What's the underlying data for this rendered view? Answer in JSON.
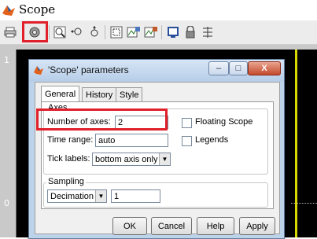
{
  "window": {
    "title": "Scope"
  },
  "toolbar": {
    "icons": [
      "print-icon",
      "parameters-icon",
      "zoom-in-icon",
      "zoom-x-icon",
      "zoom-y-icon",
      "autoscale-icon",
      "save-axes-icon",
      "restore-axes-icon",
      "float-icon",
      "lock-icon",
      "signal-selection-icon"
    ]
  },
  "plot": {
    "y_tick_top": "1",
    "y_tick_bottom": "0"
  },
  "dialog": {
    "title": "'Scope' parameters",
    "tabs": [
      "General",
      "History",
      "Style"
    ],
    "active_tab": "General",
    "axes_group": {
      "label": "Axes",
      "number_of_axes_label": "Number of axes:",
      "number_of_axes_value": "2",
      "floating_scope_label": "Floating Scope",
      "time_range_label": "Time range:",
      "time_range_value": "auto",
      "legends_label": "Legends",
      "tick_labels_label": "Tick labels:",
      "tick_labels_value": "bottom axis only"
    },
    "sampling_group": {
      "label": "Sampling",
      "mode_value": "Decimation",
      "factor_value": "1"
    },
    "buttons": {
      "ok": "OK",
      "cancel": "Cancel",
      "help": "Help",
      "apply": "Apply"
    },
    "window_buttons": {
      "minimize": "–",
      "maximize": "□",
      "close": "X"
    }
  },
  "colors": {
    "highlight": "#e0202a",
    "plot_background": "#000000",
    "signal_trace": "#d8d800"
  }
}
